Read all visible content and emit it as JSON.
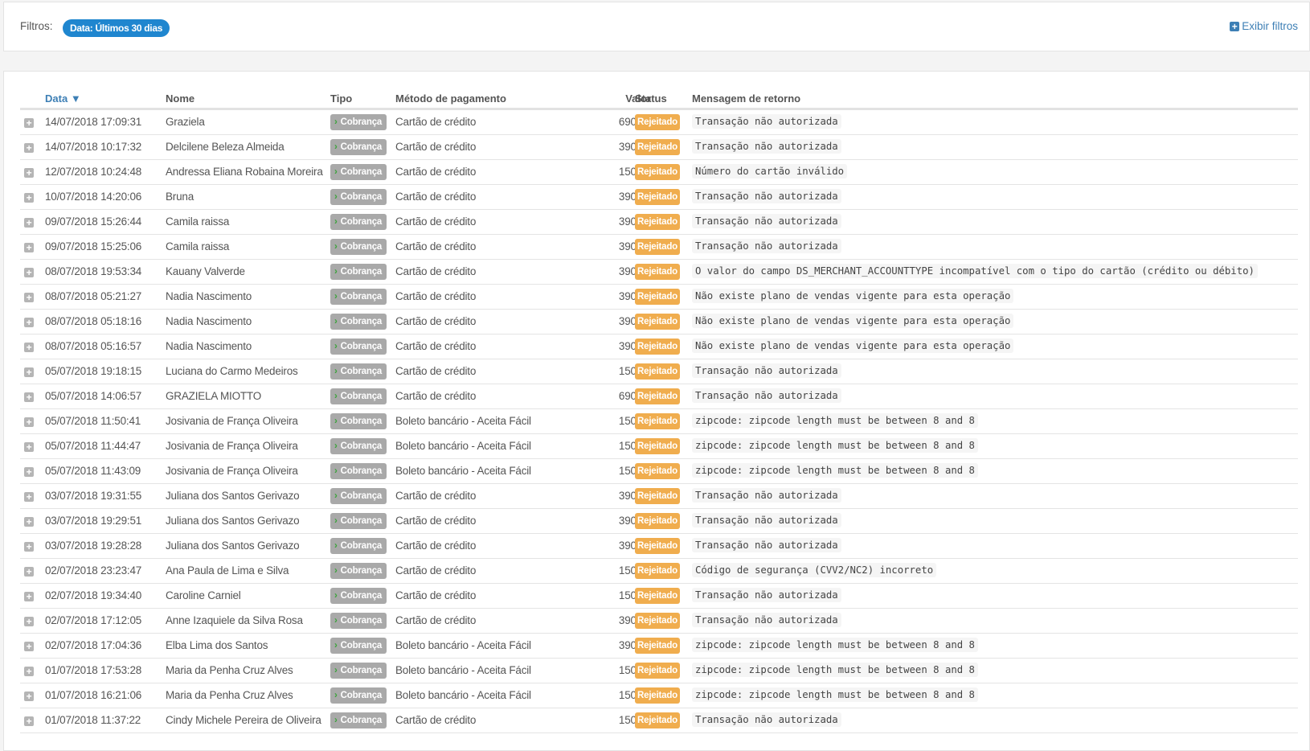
{
  "filters": {
    "label": "Filtros:",
    "chip": "Data: Últimos 30 dias",
    "show_label": "Exibir filtros"
  },
  "table": {
    "headers": {
      "date": "Data",
      "sort_icon": "▼",
      "name": "Nome",
      "tipo": "Tipo",
      "method": "Método de pagamento",
      "value": "Valor",
      "status": "Status",
      "message": "Mensagem de retorno"
    },
    "rows": [
      [
        "14/07/2018 17:09:31",
        "Graziela",
        "Cobrança",
        "Cartão de crédito",
        "690,00",
        "Rejeitado",
        "Transação não autorizada"
      ],
      [
        "14/07/2018 10:17:32",
        "Delcilene Beleza Almeida",
        "Cobrança",
        "Cartão de crédito",
        "390,00",
        "Rejeitado",
        "Transação não autorizada"
      ],
      [
        "12/07/2018 10:24:48",
        "Andressa Eliana Robaina Moreira",
        "Cobrança",
        "Cartão de crédito",
        "150,00",
        "Rejeitado",
        "Número do cartão inválido"
      ],
      [
        "10/07/2018 14:20:06",
        "Bruna",
        "Cobrança",
        "Cartão de crédito",
        "390,00",
        "Rejeitado",
        "Transação não autorizada"
      ],
      [
        "09/07/2018 15:26:44",
        "Camila raissa",
        "Cobrança",
        "Cartão de crédito",
        "390,00",
        "Rejeitado",
        "Transação não autorizada"
      ],
      [
        "09/07/2018 15:25:06",
        "Camila raissa",
        "Cobrança",
        "Cartão de crédito",
        "390,00",
        "Rejeitado",
        "Transação não autorizada"
      ],
      [
        "08/07/2018 19:53:34",
        "Kauany Valverde",
        "Cobrança",
        "Cartão de crédito",
        "390,00",
        "Rejeitado",
        "O valor do campo DS_MERCHANT_ACCOUNTTYPE incompatível com o tipo do cartão (crédito ou débito)"
      ],
      [
        "08/07/2018 05:21:27",
        "Nadia Nascimento",
        "Cobrança",
        "Cartão de crédito",
        "390,00",
        "Rejeitado",
        "Não existe plano de vendas vigente para esta operação"
      ],
      [
        "08/07/2018 05:18:16",
        "Nadia Nascimento",
        "Cobrança",
        "Cartão de crédito",
        "390,00",
        "Rejeitado",
        "Não existe plano de vendas vigente para esta operação"
      ],
      [
        "08/07/2018 05:16:57",
        "Nadia Nascimento",
        "Cobrança",
        "Cartão de crédito",
        "390,00",
        "Rejeitado",
        "Não existe plano de vendas vigente para esta operação"
      ],
      [
        "05/07/2018 19:18:15",
        "Luciana do Carmo Medeiros",
        "Cobrança",
        "Cartão de crédito",
        "150,00",
        "Rejeitado",
        "Transação não autorizada"
      ],
      [
        "05/07/2018 14:06:57",
        "GRAZIELA MIOTTO",
        "Cobrança",
        "Cartão de crédito",
        "690,00",
        "Rejeitado",
        "Transação não autorizada"
      ],
      [
        "05/07/2018 11:50:41",
        "Josivania de França Oliveira",
        "Cobrança",
        "Boleto bancário - Aceita Fácil",
        "150,00",
        "Rejeitado",
        "zipcode: zipcode length must be between 8 and 8"
      ],
      [
        "05/07/2018 11:44:47",
        "Josivania de França Oliveira",
        "Cobrança",
        "Boleto bancário - Aceita Fácil",
        "150,00",
        "Rejeitado",
        "zipcode: zipcode length must be between 8 and 8"
      ],
      [
        "05/07/2018 11:43:09",
        "Josivania de França Oliveira",
        "Cobrança",
        "Boleto bancário - Aceita Fácil",
        "150,00",
        "Rejeitado",
        "zipcode: zipcode length must be between 8 and 8"
      ],
      [
        "03/07/2018 19:31:55",
        "Juliana dos Santos Gerivazo",
        "Cobrança",
        "Cartão de crédito",
        "390,00",
        "Rejeitado",
        "Transação não autorizada"
      ],
      [
        "03/07/2018 19:29:51",
        "Juliana dos Santos Gerivazo",
        "Cobrança",
        "Cartão de crédito",
        "390,00",
        "Rejeitado",
        "Transação não autorizada"
      ],
      [
        "03/07/2018 19:28:28",
        "Juliana dos Santos Gerivazo",
        "Cobrança",
        "Cartão de crédito",
        "390,00",
        "Rejeitado",
        "Transação não autorizada"
      ],
      [
        "02/07/2018 23:23:47",
        "Ana Paula de Lima e Silva",
        "Cobrança",
        "Cartão de crédito",
        "150,00",
        "Rejeitado",
        "Código de segurança (CVV2/NC2) incorreto"
      ],
      [
        "02/07/2018 19:34:40",
        "Caroline Carniel",
        "Cobrança",
        "Cartão de crédito",
        "150,00",
        "Rejeitado",
        "Transação não autorizada"
      ],
      [
        "02/07/2018 17:12:05",
        "Anne Izaquiele da Silva Rosa",
        "Cobrança",
        "Cartão de crédito",
        "390,00",
        "Rejeitado",
        "Transação não autorizada"
      ],
      [
        "02/07/2018 17:04:36",
        "Elba Lima dos Santos",
        "Cobrança",
        "Boleto bancário - Aceita Fácil",
        "390,00",
        "Rejeitado",
        "zipcode: zipcode length must be between 8 and 8"
      ],
      [
        "01/07/2018 17:53:28",
        "Maria da Penha Cruz Alves",
        "Cobrança",
        "Boleto bancário - Aceita Fácil",
        "150,00",
        "Rejeitado",
        "zipcode: zipcode length must be between 8 and 8"
      ],
      [
        "01/07/2018 16:21:06",
        "Maria da Penha Cruz Alves",
        "Cobrança",
        "Boleto bancário - Aceita Fácil",
        "150,00",
        "Rejeitado",
        "zipcode: zipcode length must be between 8 and 8"
      ],
      [
        "01/07/2018 11:37:22",
        "Cindy Michele Pereira de Oliveira",
        "Cobrança",
        "Cartão de crédito",
        "150,00",
        "Rejeitado",
        "Transação não autorizada"
      ]
    ]
  },
  "colors": {
    "accent": "#1f86cf",
    "status": "#f0ad4e",
    "tag": "#a9a9a9"
  }
}
